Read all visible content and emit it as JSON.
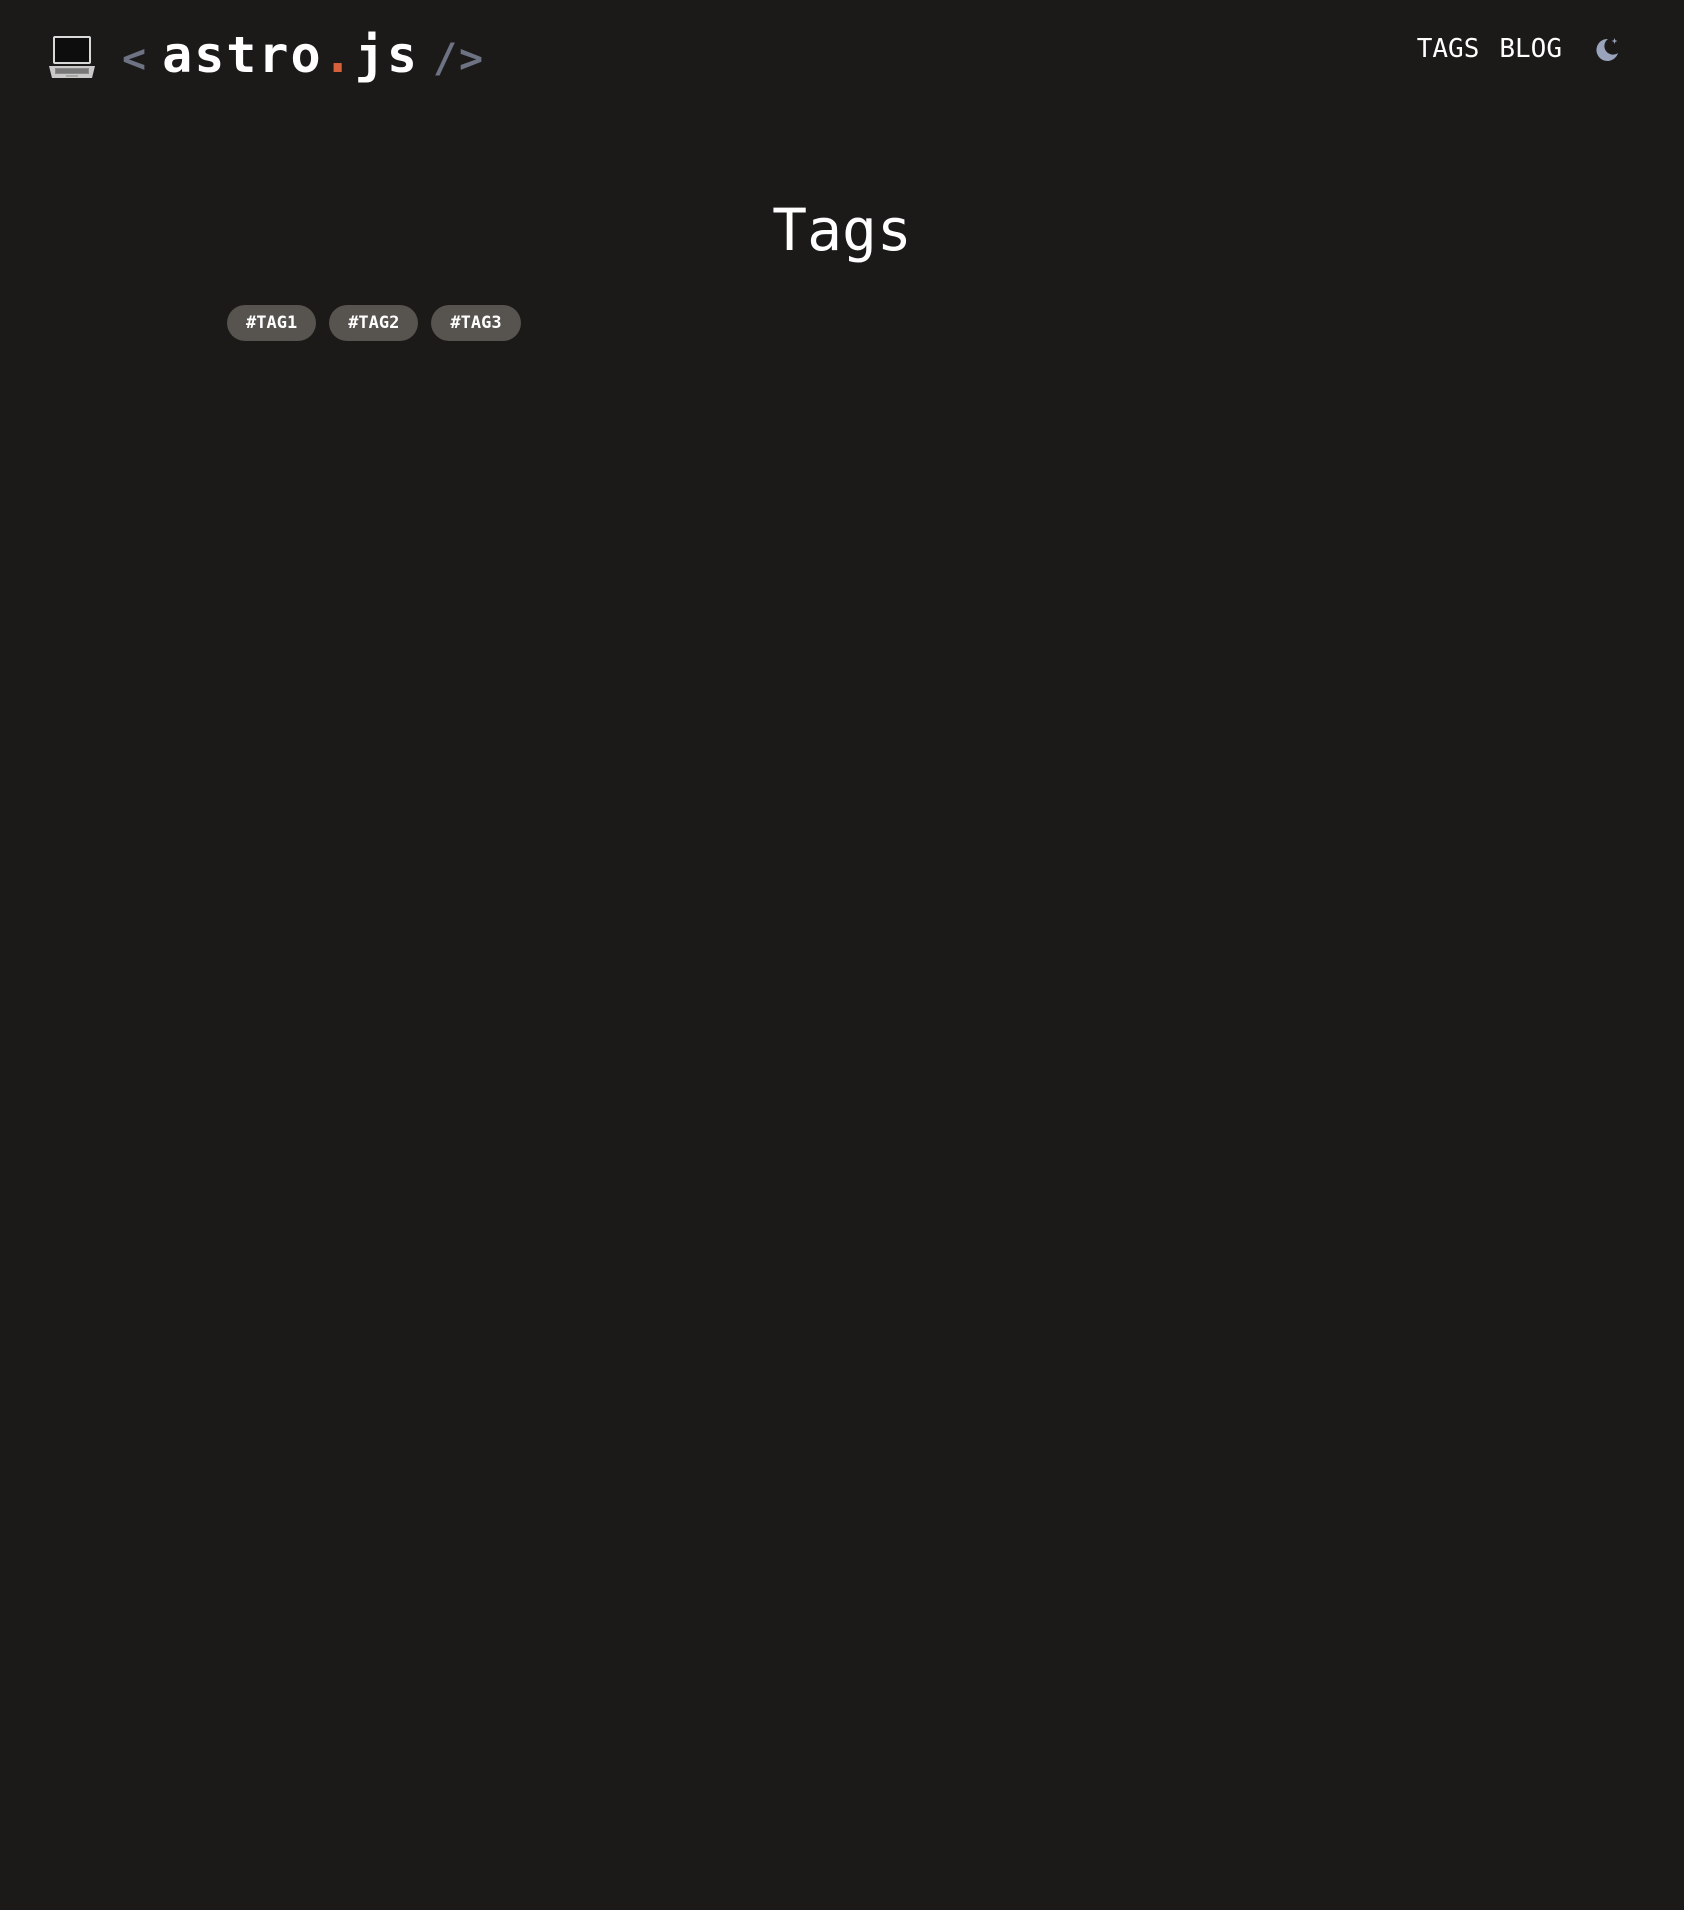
{
  "header": {
    "logo": {
      "open_bracket": "<",
      "name": "astro",
      "dot": ".",
      "ext": "js",
      "close_bracket": "/>"
    },
    "nav": [
      {
        "label": "TAGS"
      },
      {
        "label": "BLOG"
      }
    ],
    "theme_toggle_icon": "moon-icon"
  },
  "main": {
    "title": "Tags",
    "tags": [
      {
        "label": "#TAG1"
      },
      {
        "label": "#TAG2"
      },
      {
        "label": "#TAG3"
      }
    ]
  },
  "colors": {
    "background": "#1b1a19",
    "text": "#ffffff",
    "bracket": "#6e7383",
    "accent_dot": "#d5603a",
    "tag_background": "#57534e",
    "moon": "#9aa3bc"
  }
}
